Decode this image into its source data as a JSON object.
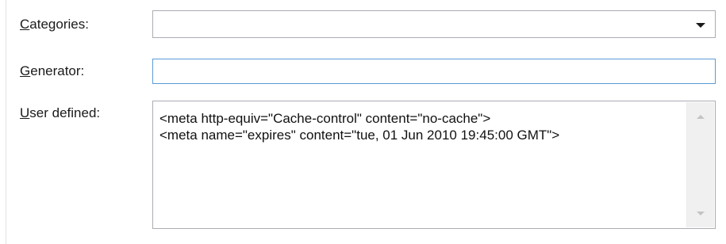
{
  "form": {
    "categories": {
      "label_mnemonic": "C",
      "label_rest": "ategories:",
      "value": ""
    },
    "generator": {
      "label_mnemonic": "G",
      "label_rest": "enerator:",
      "value": ""
    },
    "user_defined": {
      "label_mnemonic": "U",
      "label_rest": "ser defined:",
      "lines": [
        "<meta http-equiv=\"Cache-control\" content=\"no-cache\">",
        "<meta name=\"expires\" content=\"tue, 01 Jun 2010 19:45:00 GMT\">"
      ]
    }
  },
  "icons": {
    "dropdown": "chevron-down-icon",
    "scroll_up": "scroll-up-arrow-icon",
    "scroll_down": "scroll-down-arrow-icon"
  },
  "colors": {
    "focus_border": "#5b9bd5",
    "field_border": "#abadb3",
    "scrollbar_track": "#f0f0f0",
    "scroll_arrow_disabled": "#c4c4c4"
  }
}
